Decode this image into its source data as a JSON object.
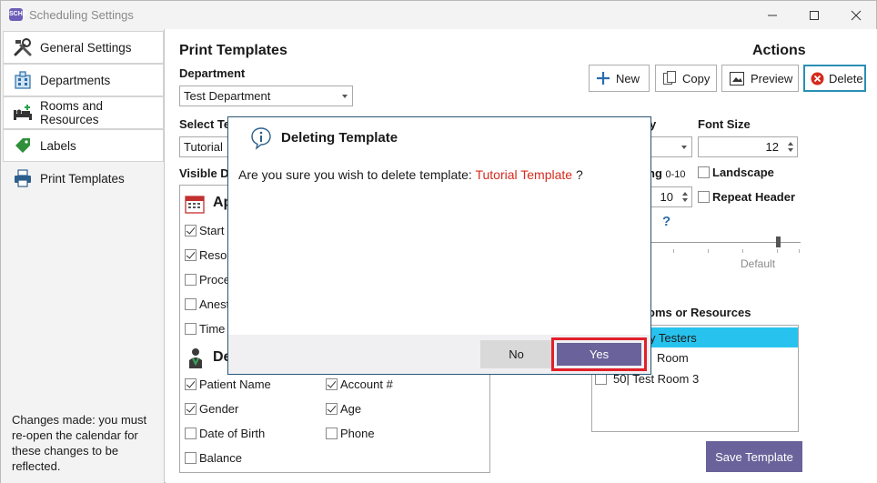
{
  "window": {
    "title": "Scheduling Settings",
    "app_icon_text": "SCHD"
  },
  "sidebar": {
    "items": [
      {
        "label": "General Settings",
        "icon": "tools-icon"
      },
      {
        "label": "Departments",
        "icon": "building-icon"
      },
      {
        "label": "Rooms and Resources",
        "icon": "bed-icon"
      },
      {
        "label": "Labels",
        "icon": "tag-icon"
      },
      {
        "label": "Print Templates",
        "icon": "printer-icon"
      }
    ],
    "note": "Changes made: you must re-open the calendar for these changes to be reflected."
  },
  "main": {
    "title": "Print Templates",
    "department_label": "Department",
    "department_value": "Test Department",
    "select_template_label": "Select Te",
    "select_template_value": "Tutorial",
    "visible_data_label": "Visible Da",
    "appt_section_label": "Ap",
    "demo_section_label": "De",
    "appt_fields": [
      {
        "label": "Start T",
        "checked": true
      },
      {
        "label": "Resou",
        "checked": true
      },
      {
        "label": "Proce",
        "checked": false
      },
      {
        "label": "Anest",
        "checked": false
      },
      {
        "label": "Time",
        "checked": false
      }
    ],
    "demo_fields_left": [
      {
        "label": "Patient Name",
        "checked": true
      },
      {
        "label": "Gender",
        "checked": true
      },
      {
        "label": "Date of Birth",
        "checked": false
      },
      {
        "label": "Balance",
        "checked": false
      }
    ],
    "demo_fields_right": [
      {
        "label": "Account #",
        "checked": true
      },
      {
        "label": "Age",
        "checked": true
      },
      {
        "label": "Phone",
        "checked": false
      }
    ]
  },
  "actions": {
    "title": "Actions",
    "new_label": "New",
    "copy_label": "Copy",
    "preview_label": "Preview",
    "delete_label": "Delete"
  },
  "options": {
    "font_family_label_partial": "y",
    "font_size_label": "Font Size",
    "font_size_value": "12",
    "spacing_label_partial": "ng",
    "spacing_range": "0-10",
    "spacing_value": "10",
    "landscape_label": "Landscape",
    "landscape_checked": false,
    "repeat_header_label": "Repeat Header",
    "repeat_header_checked": false,
    "help_symbol": "?",
    "slider_default_label": "Default",
    "rooms_label_partial": "oms or Resources",
    "rooms": [
      {
        "label": "y Testers",
        "selected": true,
        "show_checkbox": false
      },
      {
        "label": "Room",
        "selected": false,
        "show_checkbox": false
      },
      {
        "label": "50| Test Room 3",
        "selected": false,
        "show_checkbox": true,
        "checked": false
      }
    ],
    "save_label": "Save Template"
  },
  "dialog": {
    "title": "Deleting Template",
    "message_prefix": "Are you sure you wish to delete template: ",
    "template_name": "Tutorial Template",
    "message_suffix": " ?",
    "no_label": "No",
    "yes_label": "Yes"
  },
  "colors": {
    "accent_purple": "#6a629a",
    "selection_cyan": "#27c3ee",
    "warning_red": "#d52b1e",
    "highlight_border": "#e2202a",
    "delete_border": "#2a8fb3"
  }
}
